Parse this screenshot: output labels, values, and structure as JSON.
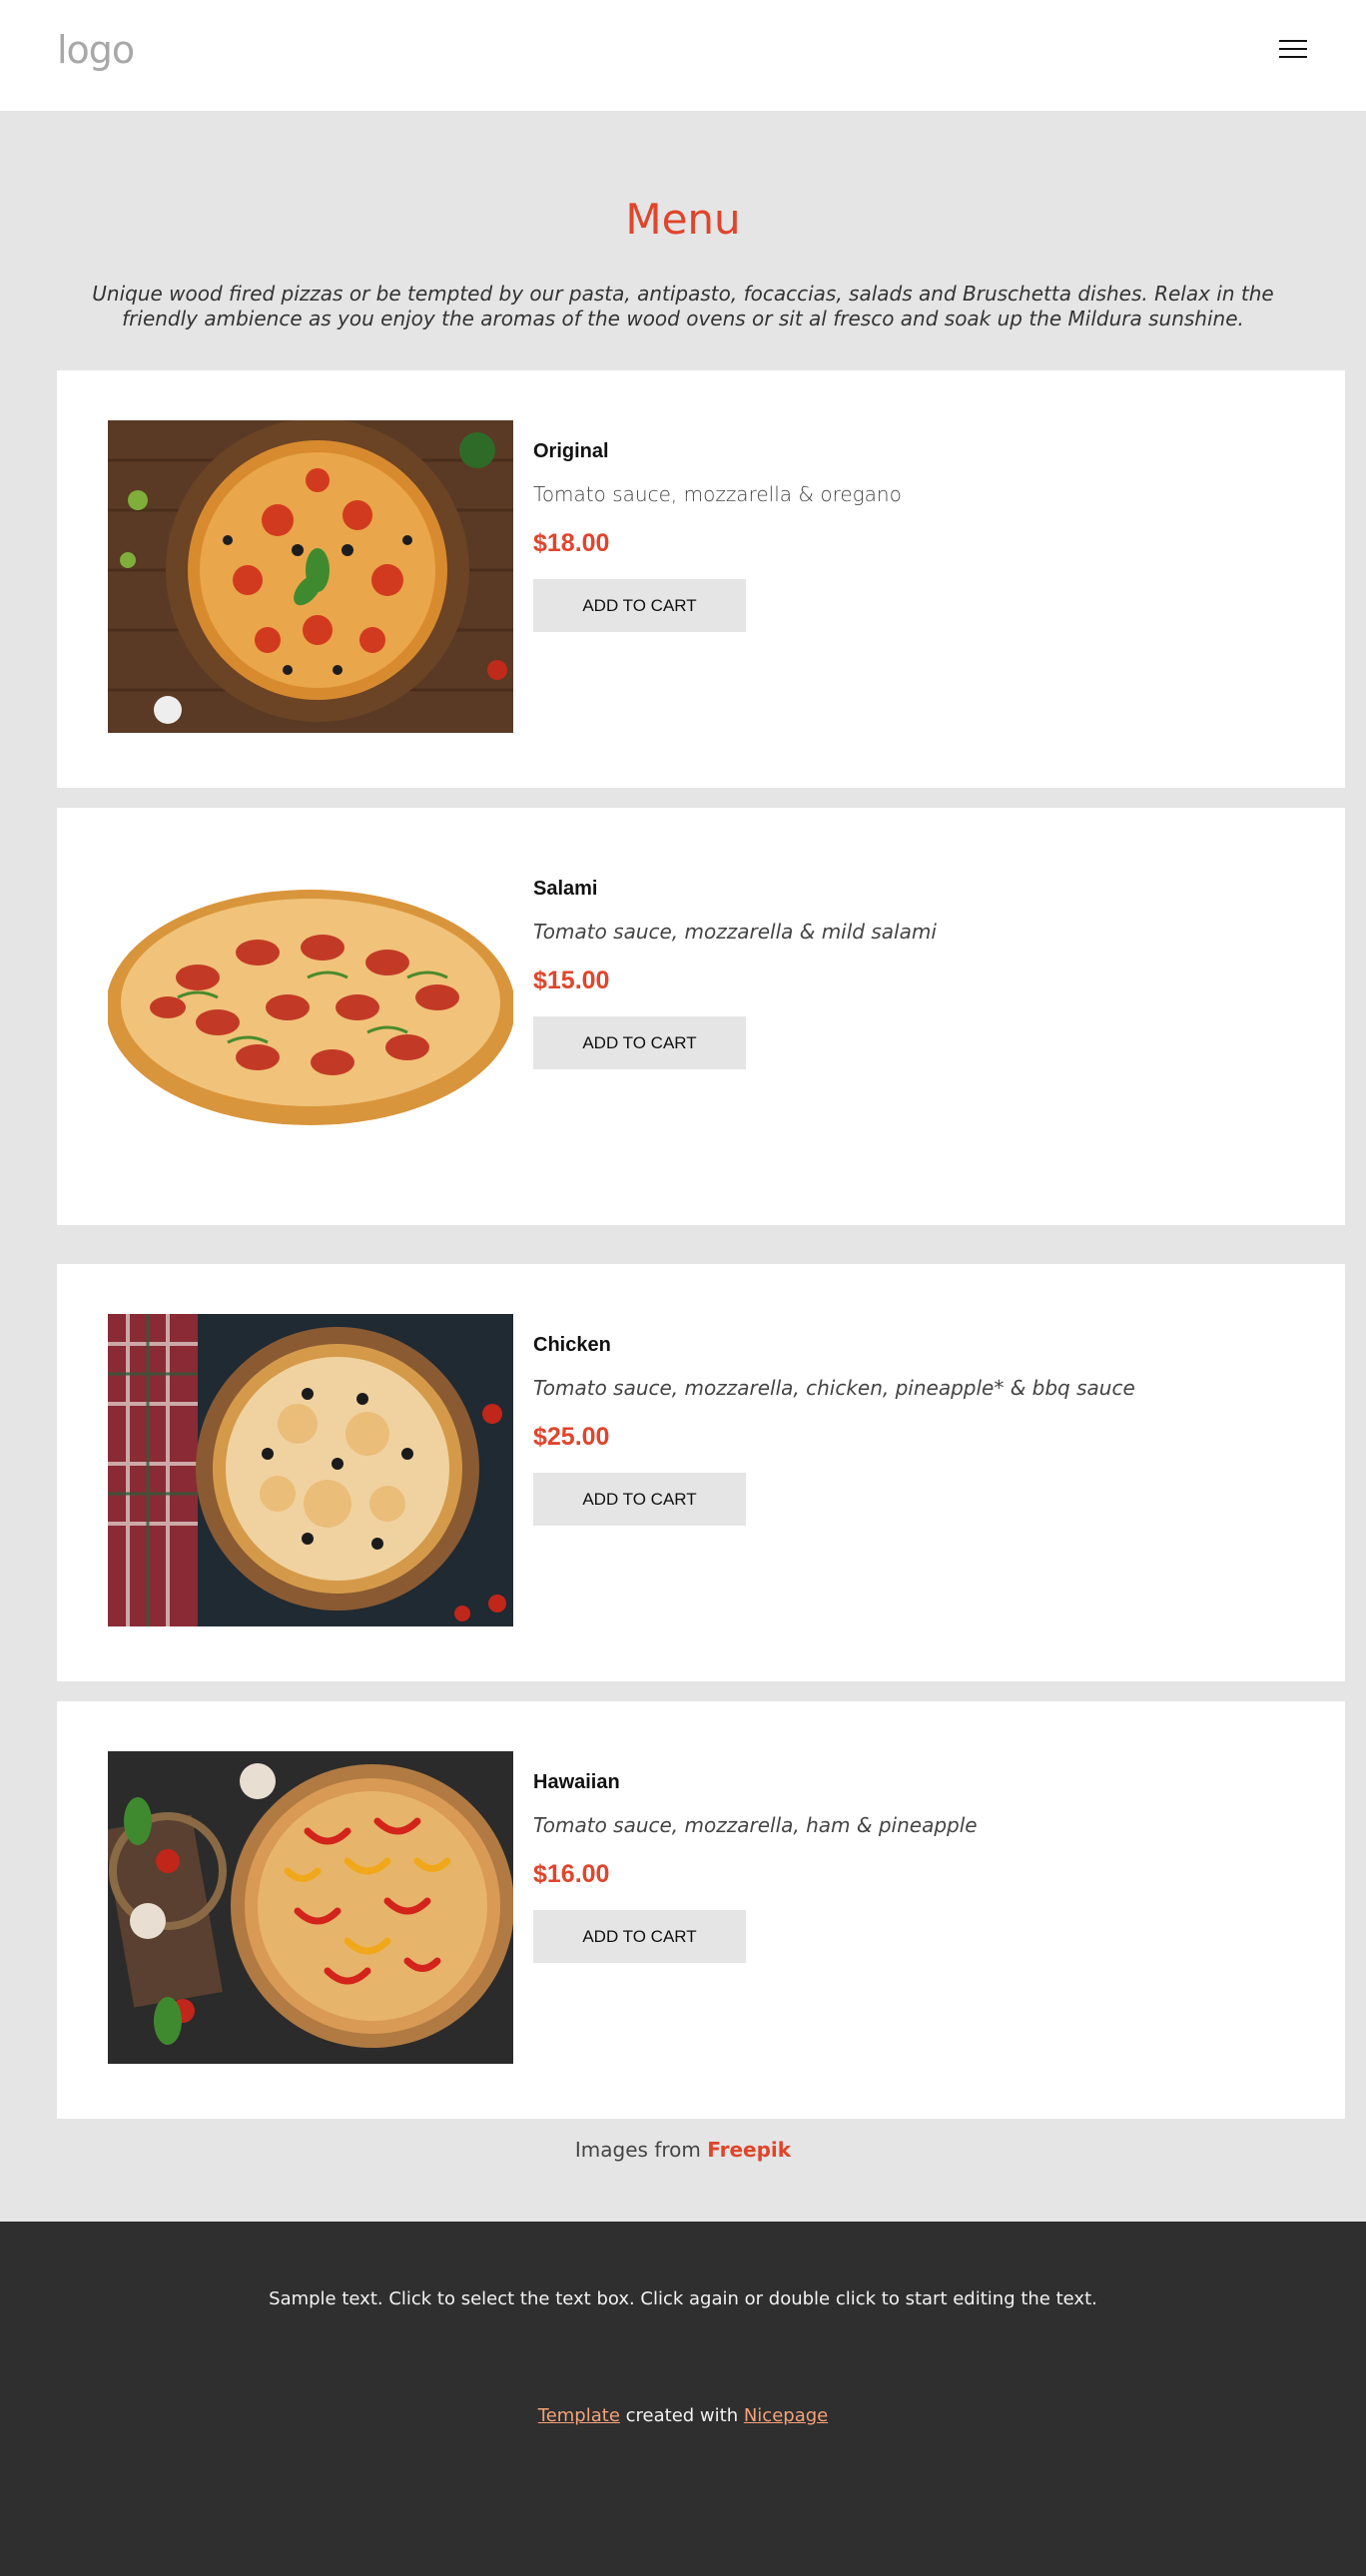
{
  "header": {
    "logo": "logo",
    "menu_icon": "hamburger-menu-icon"
  },
  "menu": {
    "title": "Menu",
    "intro": "Unique wood fired pizzas or be tempted by our pasta, antipasto, focaccias, salads and Bruschetta dishes. Relax in the friendly ambience as you enjoy the aromas of the wood ovens or sit al fresco and soak up the Mildura sunshine.",
    "items": [
      {
        "name": "Original",
        "description": "Tomato sauce, mozzarella & oregano",
        "price": "$18.00",
        "button": "ADD TO CART",
        "image": "pizza-original-image"
      },
      {
        "name": "Salami",
        "description": "Tomato sauce, mozzarella & mild salami",
        "price": "$15.00",
        "button": "ADD TO CART",
        "image": "pizza-salami-image"
      },
      {
        "name": "Chicken",
        "description": "Tomato sauce, mozzarella, chicken, pineapple* & bbq sauce",
        "price": "$25.00",
        "button": "ADD TO CART",
        "image": "pizza-chicken-image"
      },
      {
        "name": "Hawaiian",
        "description": "Tomato sauce, mozzarella, ham & pineapple",
        "price": "$16.00",
        "button": "ADD TO CART",
        "image": "pizza-hawaiian-image"
      }
    ]
  },
  "credit": {
    "prefix": "Images from ",
    "link": "Freepik"
  },
  "footer": {
    "text": "Sample text. Click to select the text box. Click again or double click to start editing the text.",
    "template_link": "Template",
    "middle": " created with ",
    "nicepage_link": "Nicepage"
  },
  "colors": {
    "accent": "#e0452b",
    "footer_bg": "#2f2f2f",
    "page_bg": "#e5e5e5",
    "footer_link": "#f4a27a"
  }
}
